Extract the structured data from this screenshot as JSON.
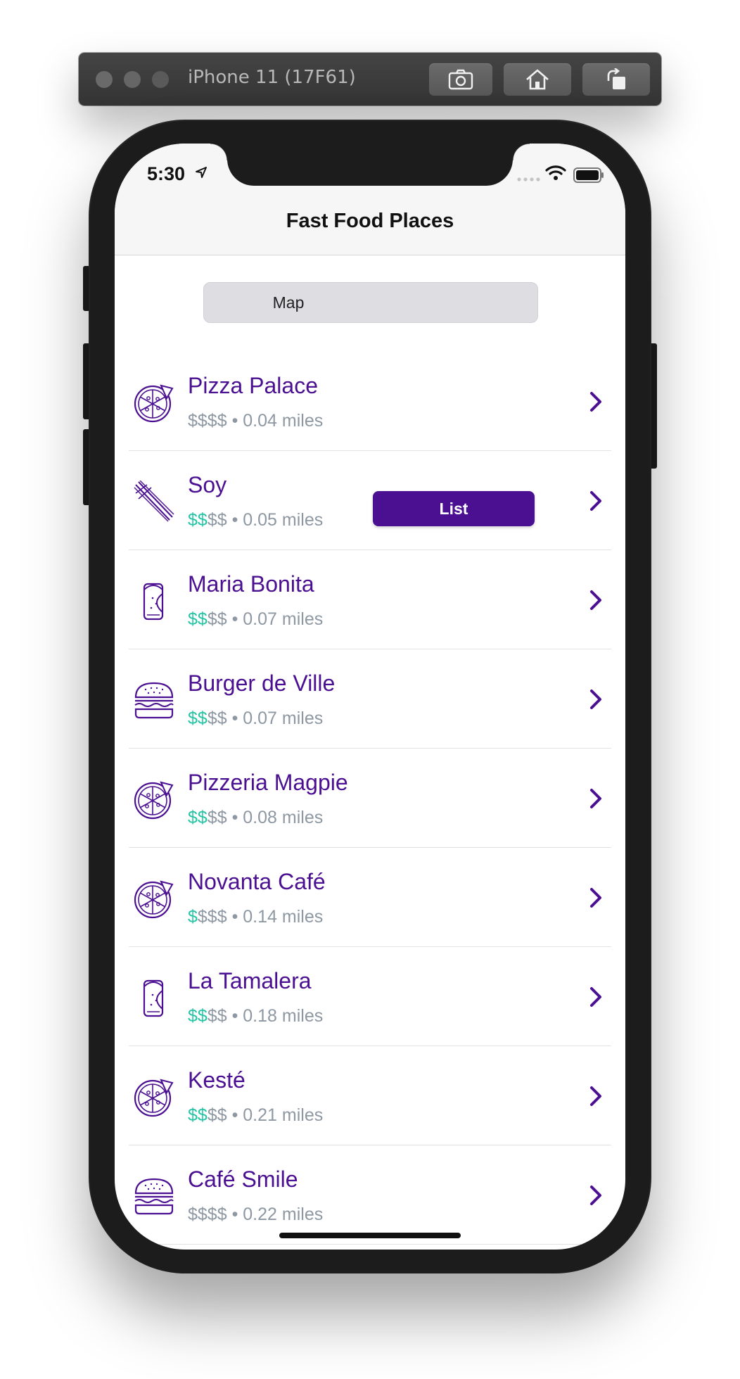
{
  "simulator": {
    "title": "iPhone 11 (17F61)",
    "buttons": [
      "screenshot-icon",
      "home-icon",
      "rotate-icon"
    ]
  },
  "status_bar": {
    "time": "5:30"
  },
  "nav": {
    "title": "Fast Food Places"
  },
  "segmented": {
    "options": [
      "Map",
      "List"
    ],
    "selected": "List"
  },
  "colors": {
    "accent": "#4b0f91",
    "price_active": "#24c4a4",
    "secondary_text": "#8e98a3"
  },
  "places": [
    {
      "name": "Pizza Palace",
      "icon": "pizza-icon",
      "price_on": "",
      "price_off": "$$$$",
      "distance": "0.04 miles"
    },
    {
      "name": "Soy",
      "icon": "chopsticks-icon",
      "price_on": "$$",
      "price_off": "$$",
      "distance": "0.05 miles"
    },
    {
      "name": "Maria Bonita",
      "icon": "burrito-icon",
      "price_on": "$$",
      "price_off": "$$",
      "distance": "0.07 miles"
    },
    {
      "name": "Burger de Ville",
      "icon": "burger-icon",
      "price_on": "$$",
      "price_off": "$$",
      "distance": "0.07 miles"
    },
    {
      "name": "Pizzeria Magpie",
      "icon": "pizza-icon",
      "price_on": "$$",
      "price_off": "$$",
      "distance": "0.08 miles"
    },
    {
      "name": "Novanta Café",
      "icon": "pizza-icon",
      "price_on": "$",
      "price_off": "$$$",
      "distance": "0.14 miles"
    },
    {
      "name": "La Tamalera",
      "icon": "burrito-icon",
      "price_on": "$$",
      "price_off": "$$",
      "distance": "0.18 miles"
    },
    {
      "name": "Kesté",
      "icon": "pizza-icon",
      "price_on": "$$",
      "price_off": "$$",
      "distance": "0.21 miles"
    },
    {
      "name": "Café Smile",
      "icon": "burger-icon",
      "price_on": "",
      "price_off": "$$$$",
      "distance": "0.22 miles"
    }
  ]
}
